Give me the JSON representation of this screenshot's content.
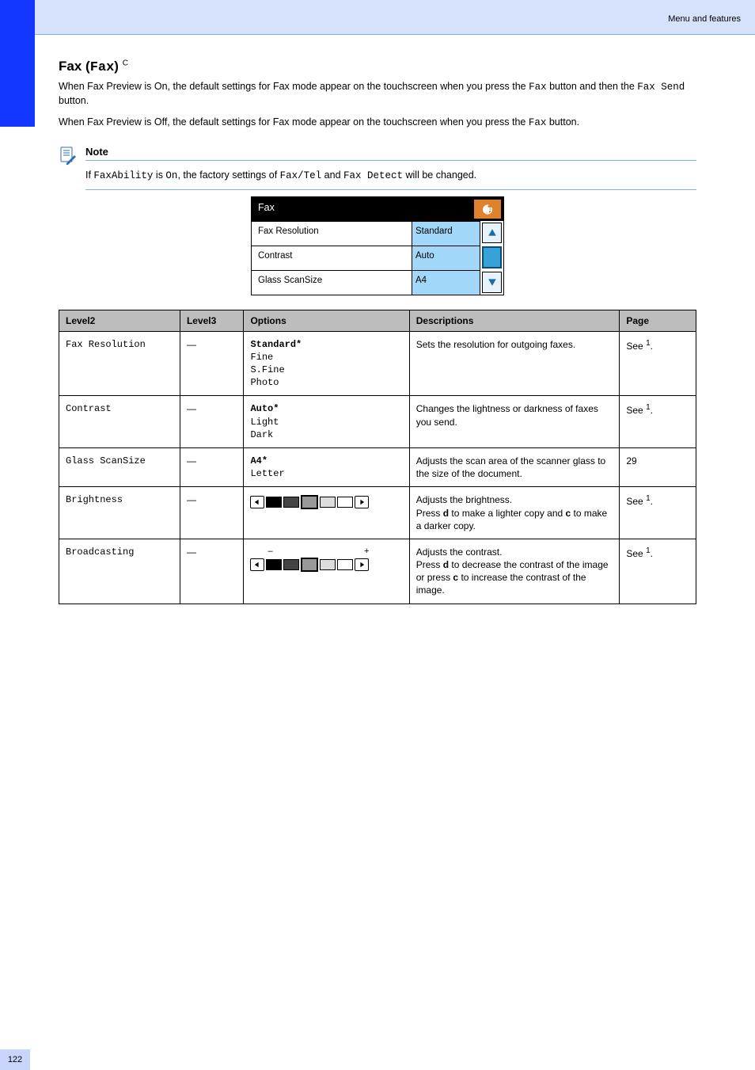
{
  "header": {
    "section_label": "Menu and features"
  },
  "intro_heading": {
    "title": "Fax (",
    "button": "Fax",
    "suffix": ")",
    "sup": "C"
  },
  "intro_para": {
    "t1": "When Fax Preview is On, the default settings for Fax mode appear on the touchscreen when you press the ",
    "btn1": "Fax",
    "t2": " button and then the ",
    "btn2": "Fax Send",
    "t3": " button."
  },
  "intro_para2": {
    "t1": "When Fax Preview is Off, the default settings for Fax mode appear on the touchscreen when you press the ",
    "btn1": "Fax",
    "t2": " button."
  },
  "note": {
    "label": "Note",
    "body_t1": "If ",
    "body_m1": "FaxAbility",
    "body_t2": " is ",
    "body_m2": "On",
    "body_t3": ", the factory settings of ",
    "body_m3": "Fax/Tel",
    "body_t4": " and ",
    "body_m4": "Fax Detect",
    "body_t5": " will be changed."
  },
  "touchscreen": {
    "title": "Fax",
    "rows": [
      {
        "k": "Fax Resolution",
        "v": "Standard"
      },
      {
        "k": "Contrast",
        "v": "Auto"
      },
      {
        "k": "Glass ScanSize",
        "v": "A4"
      }
    ]
  },
  "table_headers": {
    "c1": "Level2",
    "c2": "Level3",
    "c3": "Options",
    "c4": "Descriptions",
    "c5": "Page"
  },
  "rows": [
    {
      "level2": "Fax Resolution",
      "level3": "—",
      "options": [
        {
          "t": "Standard*",
          "b": true
        },
        {
          "t": "Fine"
        },
        {
          "t": "S.Fine"
        },
        {
          "t": "Photo"
        }
      ],
      "desc": "Sets the resolution for outgoing faxes.",
      "page": "See",
      "page_sup": "1",
      "page_dot": "."
    },
    {
      "level2": "Contrast",
      "level3": "—",
      "options": [
        {
          "t": "Auto*",
          "b": true
        },
        {
          "t": "Light"
        },
        {
          "t": "Dark"
        }
      ],
      "desc": "Changes the lightness or darkness of faxes you send.",
      "page": "See",
      "page_sup": "1",
      "page_dot": "."
    },
    {
      "level2": "Glass ScanSize",
      "level3": "—",
      "options": [
        {
          "t": "A4*",
          "b": true
        },
        {
          "t": "Letter"
        }
      ],
      "desc": "Adjusts the scan area of the scanner glass to the size of the document.",
      "page": "29"
    },
    {
      "level2": "Brightness",
      "level3": "—",
      "options": [],
      "desc_t1": "Adjusts the brightness.",
      "desc_t2a": "Press ",
      "desc_b1": "d",
      "desc_t2b": " to make a lighter copy and ",
      "desc_b2": "c",
      "desc_t2c": " to make a darker copy.",
      "page": "See",
      "page_sup": "1",
      "page_dot": ".",
      "slider": {
        "labelL": "",
        "labelR": ""
      }
    },
    {
      "level2": "Broadcasting",
      "level3": "—",
      "options": [],
      "desc_t1": "Adjusts the contrast.",
      "desc_t2a": "Press ",
      "desc_b1": "d",
      "desc_t2b": " to decrease the contrast of the image or press ",
      "desc_b2": "c",
      "desc_t2c": " to increase the contrast of the image.",
      "page": "See",
      "page_sup": "1",
      "page_dot": ".",
      "slider": {
        "labelL": "–",
        "labelR": "+"
      }
    }
  ],
  "page_number": "122"
}
